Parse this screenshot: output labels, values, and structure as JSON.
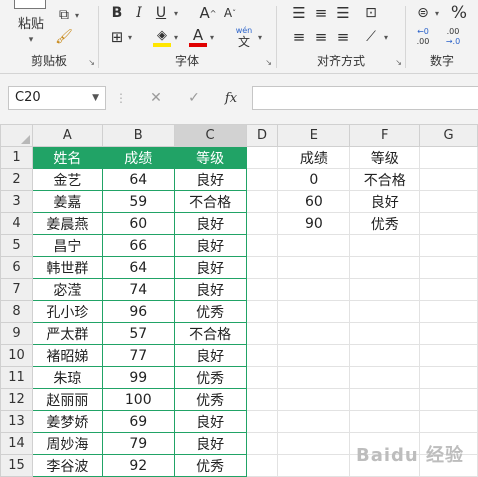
{
  "ribbon": {
    "clipboard": {
      "paste_label": "粘贴",
      "group_label": "剪贴板"
    },
    "font": {
      "bold": "B",
      "italic": "I",
      "underline": "U",
      "grow": "A",
      "shrink": "A",
      "phonetic_top": "wén",
      "phonetic_bottom": "文",
      "group_label": "字体",
      "fill_color": "#ffe600",
      "font_color": "#e00000"
    },
    "alignment": {
      "group_label": "对齐方式"
    },
    "number": {
      "percent": "%",
      "group_label": "数字",
      "inc_top": "←0",
      "inc_bottom": ".00",
      "dec_top": ".00",
      "dec_bottom": "→.0"
    }
  },
  "formula_bar": {
    "name_box": "C20",
    "fx": "fx",
    "cancel": "✕",
    "enter": "✓"
  },
  "columns": [
    "A",
    "B",
    "C",
    "D",
    "E",
    "F",
    "G"
  ],
  "table": {
    "headers": [
      "姓名",
      "成绩",
      "等级"
    ],
    "rows": [
      [
        "金艺",
        "64",
        "良好"
      ],
      [
        "姜嘉",
        "59",
        "不合格"
      ],
      [
        "姜晨燕",
        "60",
        "良好"
      ],
      [
        "昌宁",
        "66",
        "良好"
      ],
      [
        "韩世群",
        "64",
        "良好"
      ],
      [
        "宓滢",
        "74",
        "良好"
      ],
      [
        "孔小珍",
        "96",
        "优秀"
      ],
      [
        "严太群",
        "57",
        "不合格"
      ],
      [
        "褚昭娣",
        "77",
        "良好"
      ],
      [
        "朱琼",
        "99",
        "优秀"
      ],
      [
        "赵丽丽",
        "100",
        "优秀"
      ],
      [
        "姜梦娇",
        "69",
        "良好"
      ],
      [
        "周妙海",
        "79",
        "良好"
      ],
      [
        "李谷波",
        "92",
        "优秀"
      ]
    ]
  },
  "lookup": {
    "headers": [
      "成绩",
      "等级"
    ],
    "rows": [
      [
        "0",
        "不合格"
      ],
      [
        "60",
        "良好"
      ],
      [
        "90",
        "优秀"
      ]
    ]
  },
  "row_numbers": [
    "1",
    "2",
    "3",
    "4",
    "5",
    "6",
    "7",
    "8",
    "9",
    "10",
    "11",
    "12",
    "13",
    "14",
    "15"
  ],
  "watermark": "Baidu 经验",
  "colors": {
    "accent": "#21a366",
    "header_text": "#ffffff"
  }
}
